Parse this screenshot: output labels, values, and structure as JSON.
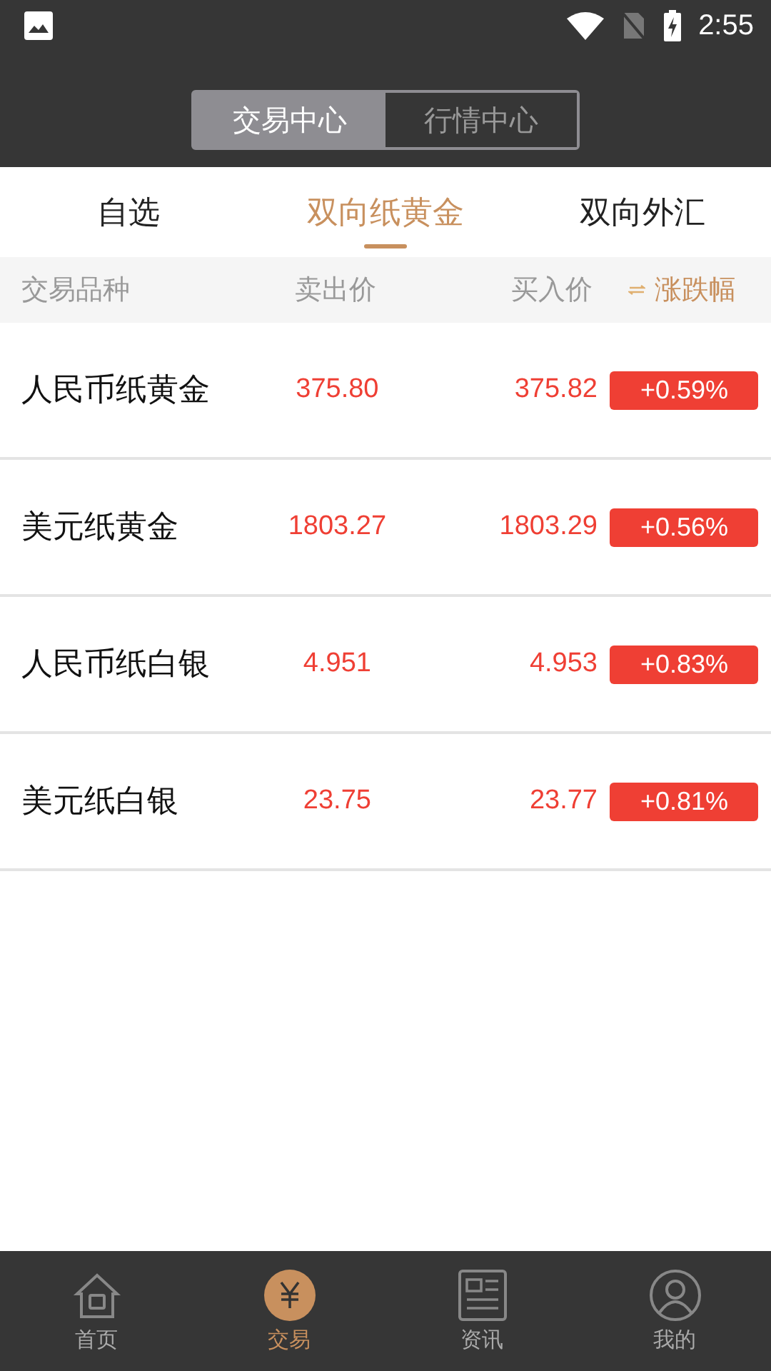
{
  "status_bar": {
    "time": "2:55"
  },
  "segments": [
    {
      "label": "交易中心",
      "selected": true
    },
    {
      "label": "行情中心",
      "selected": false
    }
  ],
  "tabs": [
    {
      "label": "自选",
      "selected": false
    },
    {
      "label": "双向纸黄金",
      "selected": true
    },
    {
      "label": "双向外汇",
      "selected": false
    }
  ],
  "table": {
    "columns": [
      "交易品种",
      "卖出价",
      "买入价",
      "涨跌幅"
    ],
    "rows": [
      {
        "name": "人民币纸黄金",
        "sell": "375.80",
        "buy": "375.82",
        "change": "+0.59%"
      },
      {
        "name": "美元纸黄金",
        "sell": "1803.27",
        "buy": "1803.29",
        "change": "+0.56%"
      },
      {
        "name": "人民币纸白银",
        "sell": "4.951",
        "buy": "4.953",
        "change": "+0.83%"
      },
      {
        "name": "美元纸白银",
        "sell": "23.75",
        "buy": "23.77",
        "change": "+0.81%"
      }
    ]
  },
  "bottom_nav": [
    {
      "label": "首页",
      "kind": "home",
      "selected": false
    },
    {
      "label": "交易",
      "kind": "trade",
      "selected": true
    },
    {
      "label": "资讯",
      "kind": "news",
      "selected": false
    },
    {
      "label": "我的",
      "kind": "profile",
      "selected": false
    }
  ]
}
